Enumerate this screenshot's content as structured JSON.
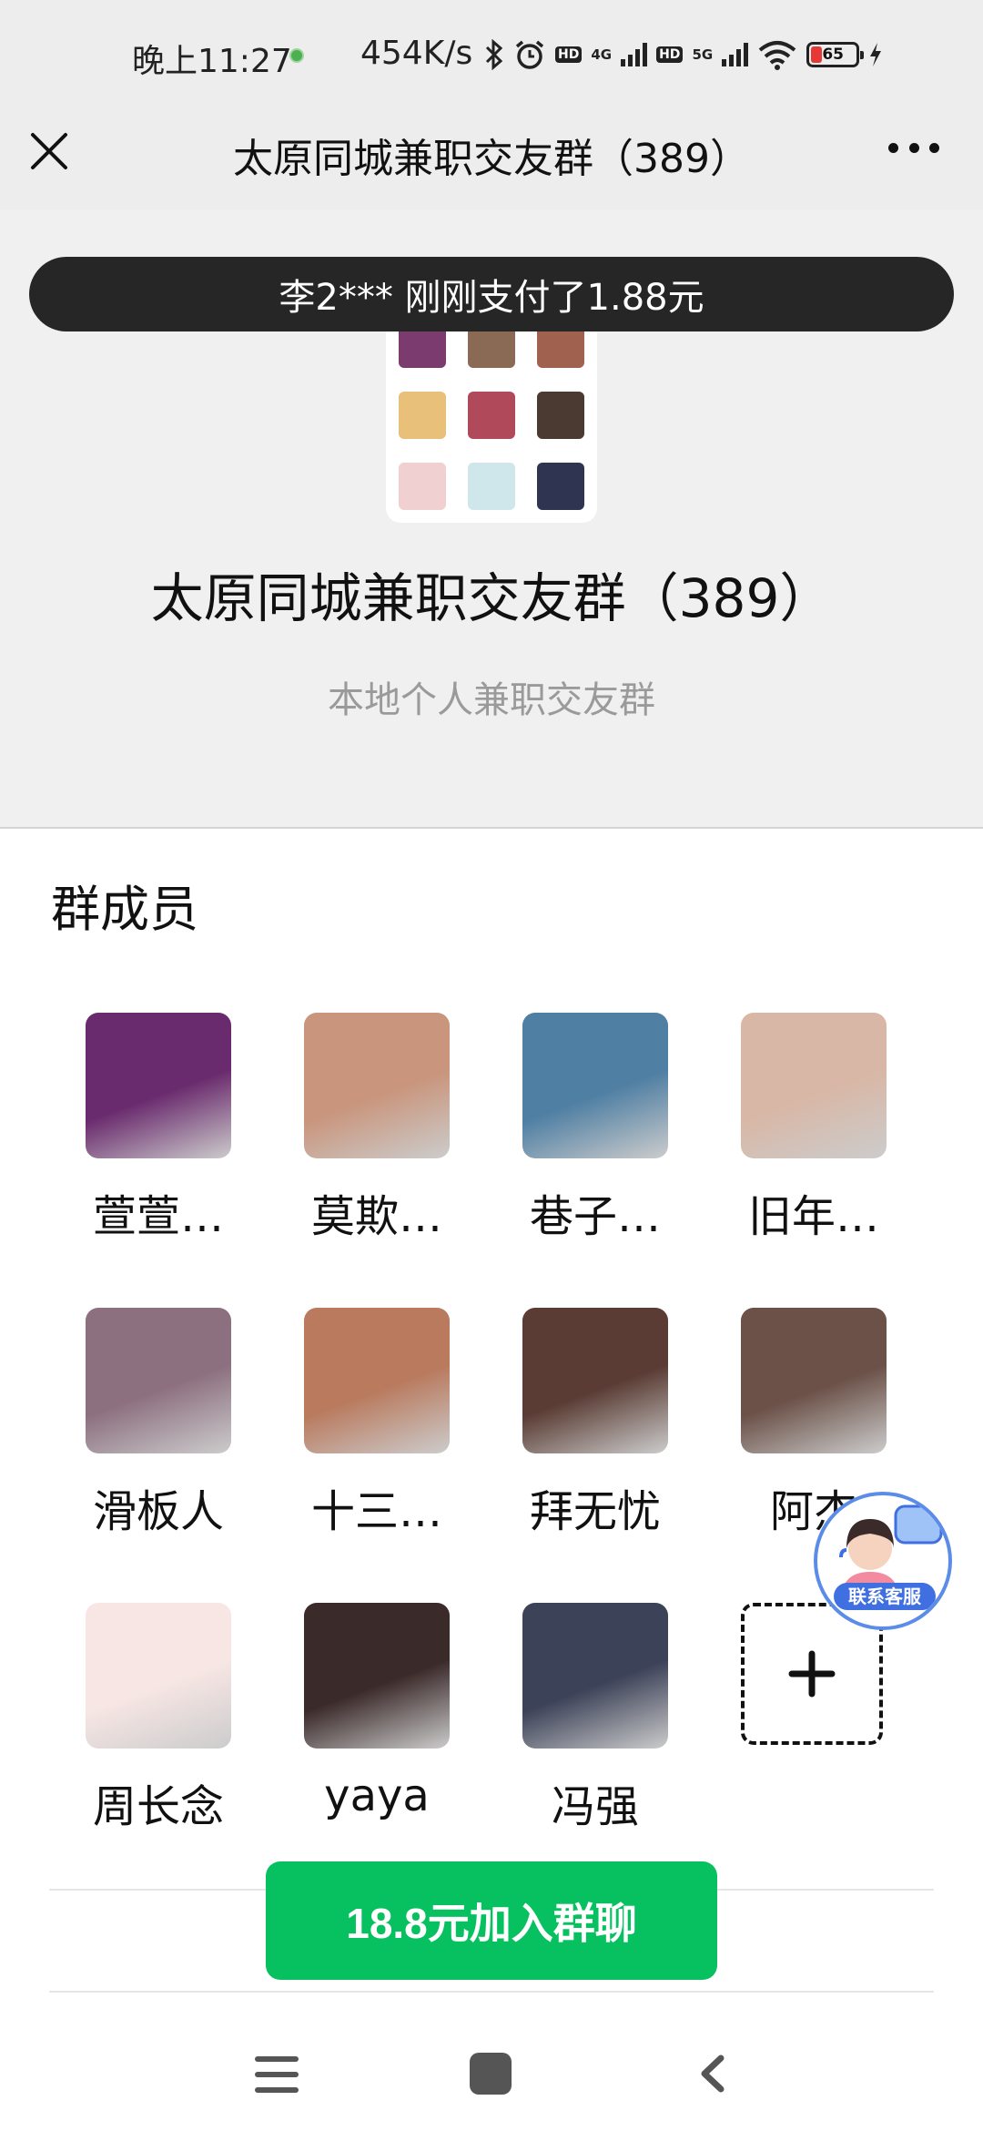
{
  "status_bar": {
    "time": "晚上11:27",
    "speed": "454K/s",
    "hd1": "HD",
    "net1": "4G",
    "hd2": "HD",
    "net2": "5G",
    "battery": "65"
  },
  "navbar": {
    "title": "太原同城兼职交友群（389）"
  },
  "toast": "李2*** 刚刚支付了1.88元",
  "group": {
    "name": "太原同城兼职交友群（389）",
    "description": "本地个人兼职交友群",
    "avatar_colors": [
      "#7b3b6e",
      "#8a6a55",
      "#a0624e",
      "#e8c07a",
      "#b04a5a",
      "#4a3a32",
      "#f0d0d0",
      "#cfe6ea",
      "#2f3550"
    ]
  },
  "members": {
    "title": "群成员",
    "items": [
      {
        "name": "萱萱…",
        "color": "#6a2b6e"
      },
      {
        "name": "莫欺…",
        "color": "#c9957c"
      },
      {
        "name": "巷子…",
        "color": "#4f7fa3"
      },
      {
        "name": "旧年…",
        "color": "#d8b7a6"
      },
      {
        "name": "滑板人",
        "color": "#8d7080"
      },
      {
        "name": "十三…",
        "color": "#b97a5e"
      },
      {
        "name": "拜无忧",
        "color": "#5a3c34"
      },
      {
        "name": "阿杰",
        "color": "#6b5148"
      },
      {
        "name": "周长念",
        "color": "#f7e6e4"
      },
      {
        "name": "yaya",
        "color": "#3b2a2a"
      },
      {
        "name": "冯强",
        "color": "#3c4258"
      }
    ]
  },
  "customer_service": {
    "label": "联系客服"
  },
  "join_button": {
    "label": "18.8元加入群聊"
  },
  "colors": {
    "accent_green": "#07c160",
    "toast_bg": "#262626",
    "service_blue": "#3f6fe0"
  }
}
